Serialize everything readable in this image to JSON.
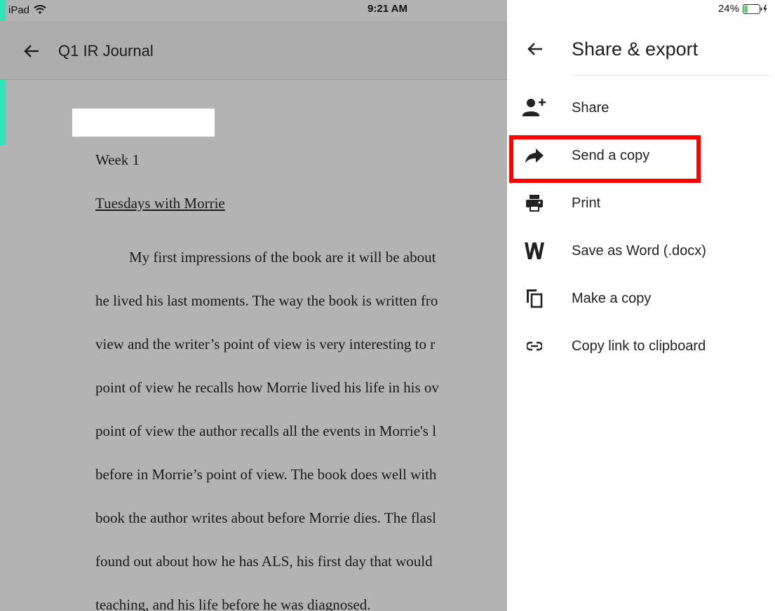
{
  "status_bar": {
    "device": "iPad",
    "time": "9:21 AM",
    "battery": "24%",
    "battery_level": 0.24,
    "icons": [
      "wifi-icon",
      "battery-icon",
      "charging-icon"
    ]
  },
  "document": {
    "title": "Q1 IR Journal",
    "back_icon": "back-arrow-icon",
    "lines": {
      "week": "Week 1",
      "book_title": "Tuesdays with Morrie",
      "body": [
        "My first impressions of the book are it will be about",
        "he lived his last moments. The way the book is written fro",
        "view and the writer’s point of view is very interesting to r",
        "point of view he recalls how Morrie lived his life in his ov",
        "point of view the author recalls all the events in Morrie's l",
        "before in Morrie’s point of view. The book does well with",
        "book the author writes about before Morrie dies. The flasl",
        "found out about how he has ALS, his first day that would",
        "teaching, and his life before he was diagnosed."
      ]
    }
  },
  "panel": {
    "title": "Share & export",
    "back_icon": "back-arrow-icon",
    "items": [
      {
        "label": "Share",
        "icon": "add-person-icon"
      },
      {
        "label": "Send a copy",
        "icon": "forward-arrow-icon",
        "highlighted": true
      },
      {
        "label": "Print",
        "icon": "printer-icon"
      },
      {
        "label": "Save as Word (.docx)",
        "icon": "word-icon"
      },
      {
        "label": "Make a copy",
        "icon": "copy-icon"
      },
      {
        "label": "Copy link to clipboard",
        "icon": "link-icon"
      }
    ]
  },
  "colors": {
    "highlight": "#ff0000",
    "accent_edge": "#2de5b8",
    "dim_overlay": "#b3b3b3"
  }
}
